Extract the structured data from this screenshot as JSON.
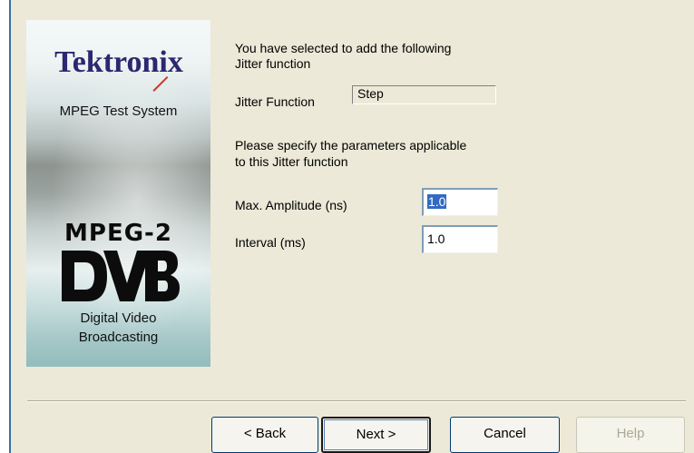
{
  "banner": {
    "logo_text": "Tektronix",
    "product": "MPEG Test System",
    "mpeg2": "MPEG-2",
    "dvb_logo_text": "DVB",
    "tagline_line1": "Digital Video",
    "tagline_line2": "Broadcasting"
  },
  "content": {
    "intro_line1": "You have selected to add the following",
    "intro_line2": "Jitter function",
    "jitter_label": "Jitter Function",
    "jitter_value": "Step",
    "params_line1": "Please specify the parameters applicable",
    "params_line2": "to this Jitter function",
    "amplitude_label": "Max. Amplitude (ns)",
    "amplitude_value": "1.0",
    "interval_label": "Interval (ms)",
    "interval_value": "1.0"
  },
  "buttons": {
    "back": "< Back",
    "next": "Next >",
    "cancel": "Cancel",
    "help": "Help"
  },
  "colors": {
    "tektronix_blue": "#2d2670",
    "accent_red": "#c83a2e",
    "selection": "#316ac5",
    "dialog_bg": "#ece9d8"
  }
}
